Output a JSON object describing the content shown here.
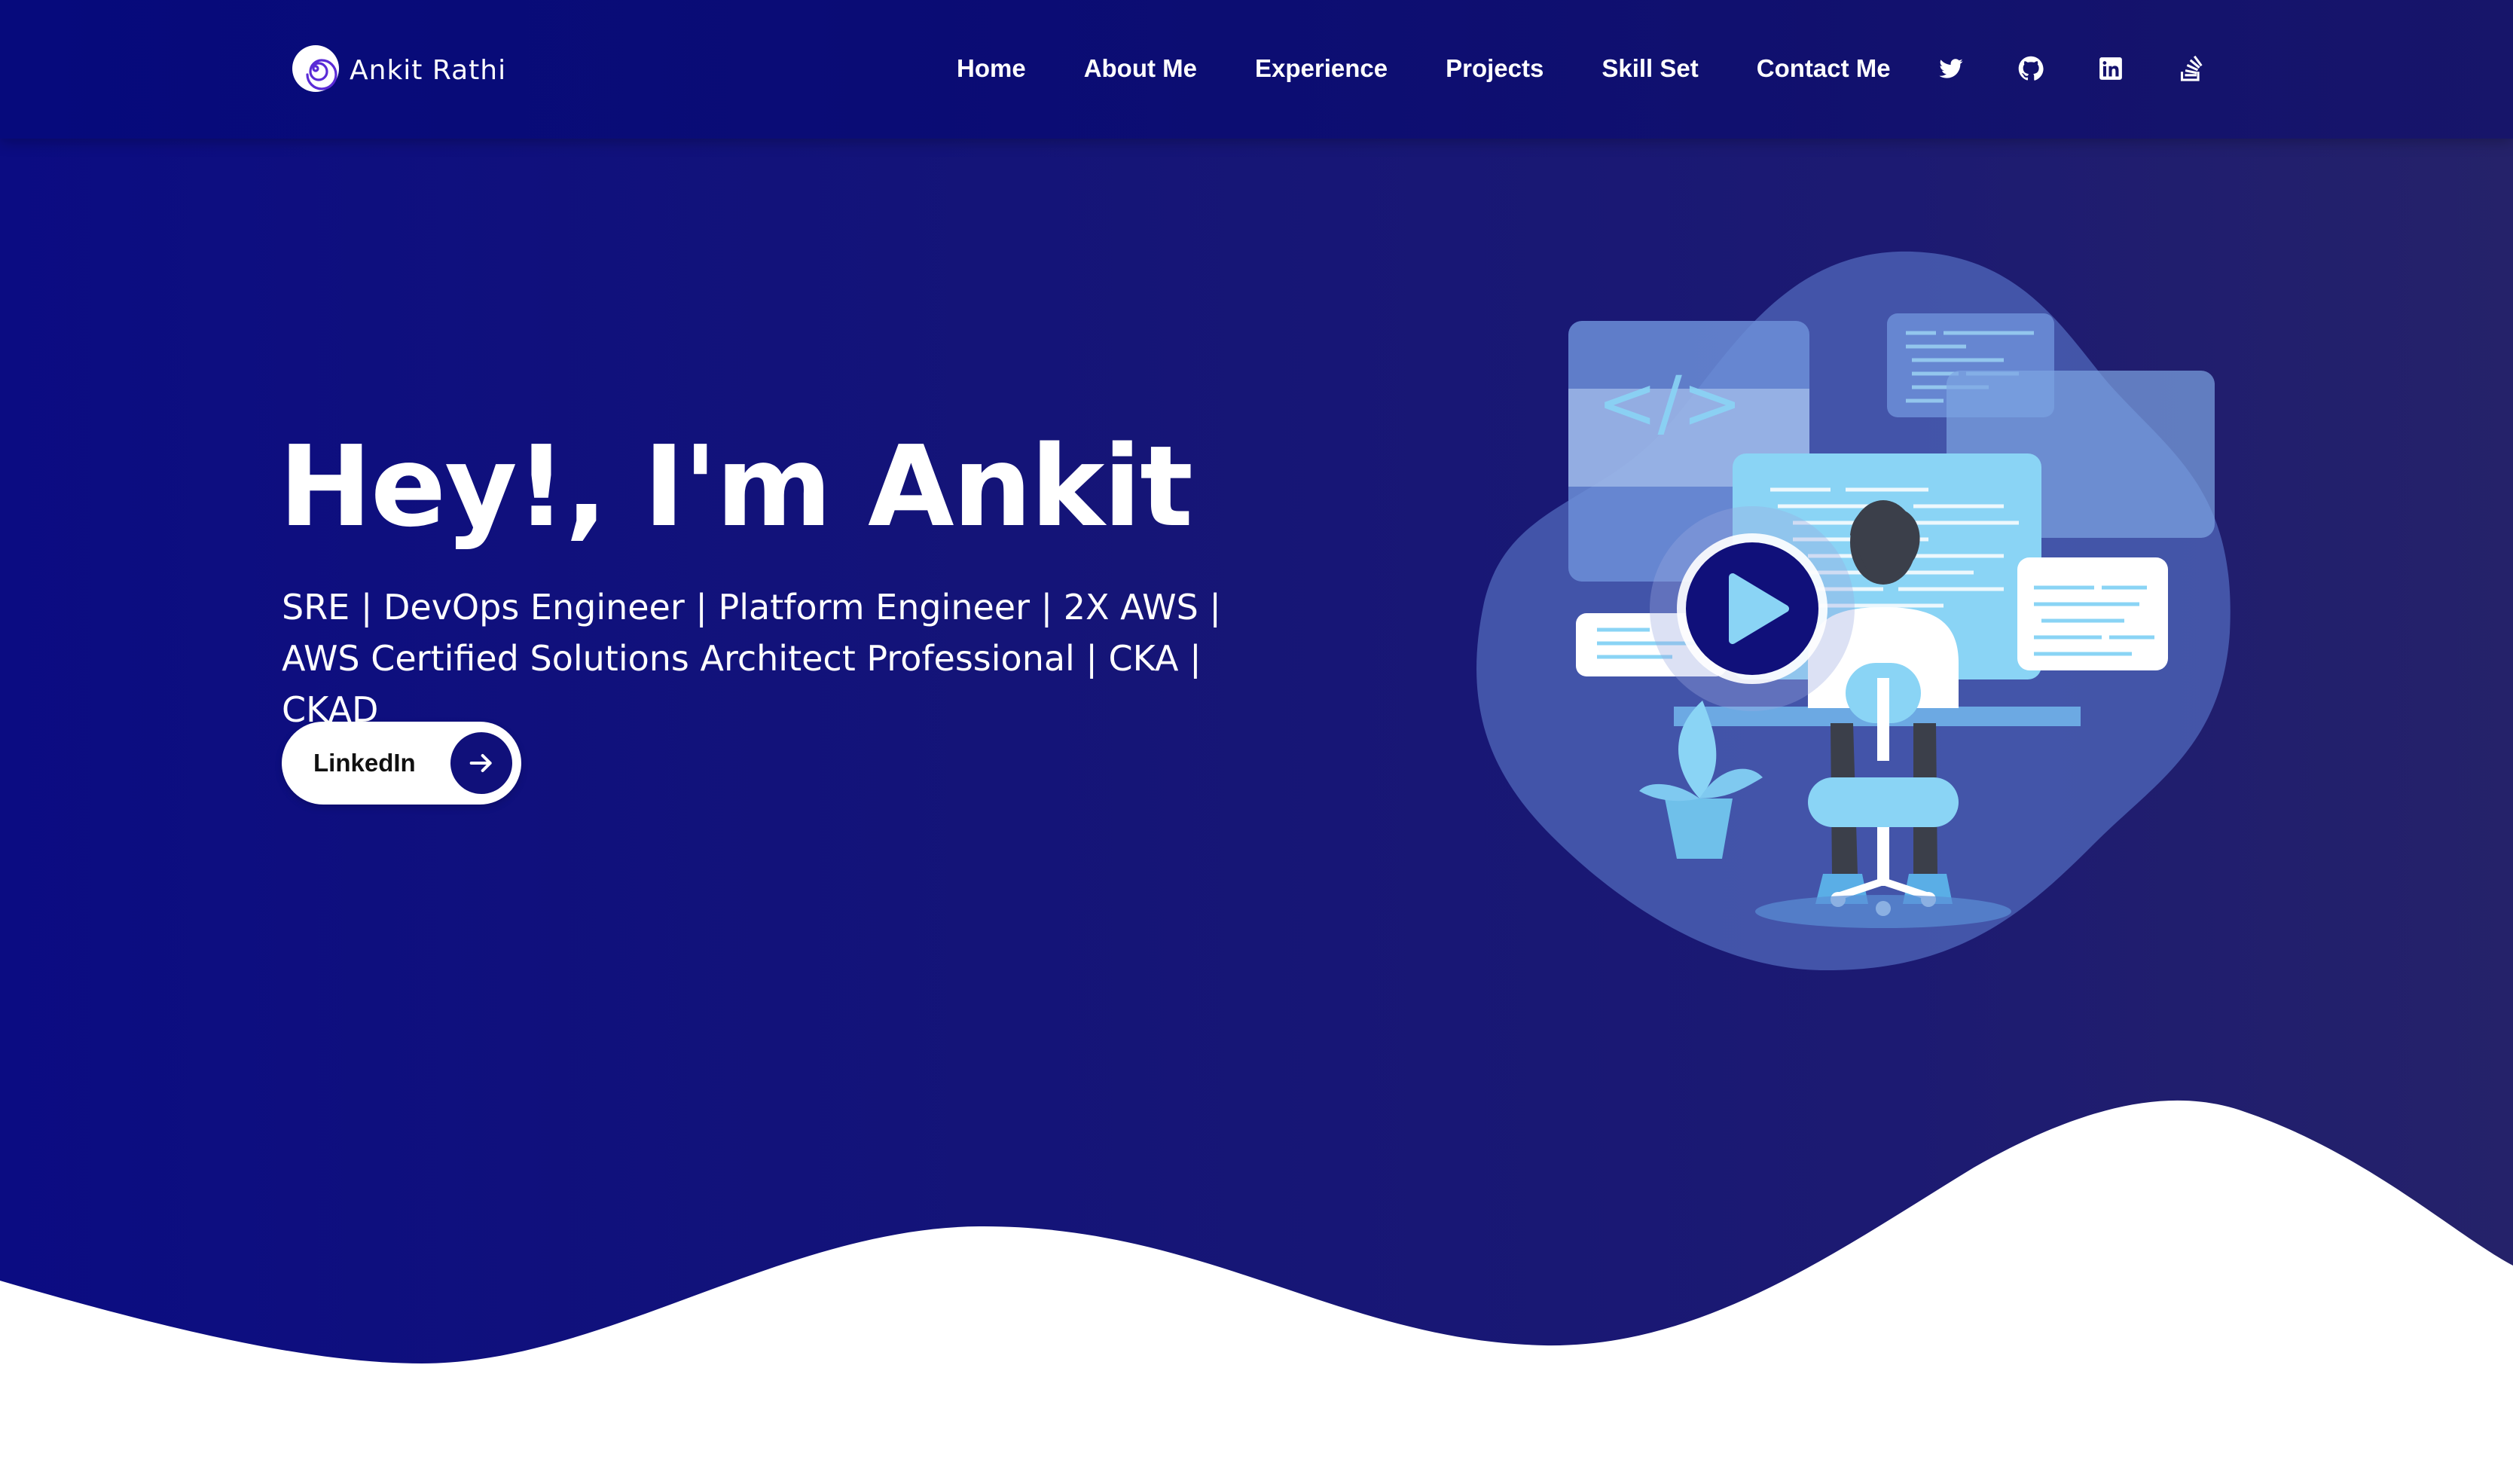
{
  "brand": {
    "name": "Ankit Rathi",
    "logo_icon": "spiral-logo-icon"
  },
  "nav": {
    "links": [
      {
        "label": "Home"
      },
      {
        "label": "About Me"
      },
      {
        "label": "Experience"
      },
      {
        "label": "Projects"
      },
      {
        "label": "Skill Set"
      },
      {
        "label": "Contact Me"
      }
    ],
    "social_icons": [
      "twitter-icon",
      "github-icon",
      "linkedin-icon",
      "stack-overflow-icon"
    ]
  },
  "hero": {
    "headline": "Hey!, I'm Ankit",
    "subtitle": "SRE | DevOps Engineer | Platform Engineer | 2X AWS | AWS Certified Solutions Architect Professional | CKA | CKAD",
    "cta_label": "LinkedIn",
    "cta_icon": "arrow-right-icon",
    "illustration_code_tag": "</>"
  },
  "colors": {
    "primary": "#0b0c82",
    "primary_dark": "#10107a",
    "accent_light_blue": "#8ad4f5",
    "white": "#ffffff"
  }
}
